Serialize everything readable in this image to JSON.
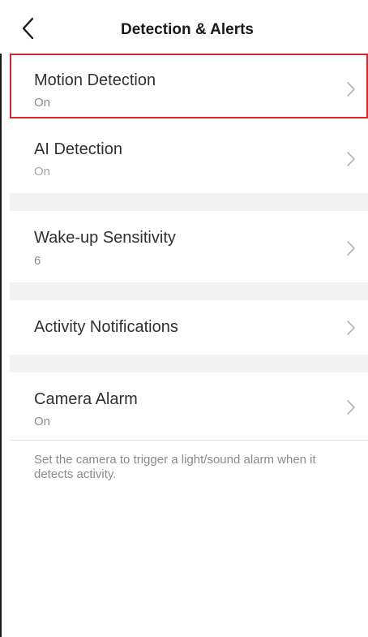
{
  "header": {
    "title": "Detection & Alerts",
    "back_icon": "chevron-left-icon"
  },
  "settings": {
    "motion_detection": {
      "label": "Motion Detection",
      "value": "On",
      "highlight_color": "#d3272a"
    },
    "ai_detection": {
      "label": "AI Detection",
      "value": "On"
    },
    "wakeup_sensitivity": {
      "label": "Wake-up Sensitivity",
      "value": "6"
    },
    "activity_notifications": {
      "label": "Activity Notifications"
    },
    "camera_alarm": {
      "label": "Camera Alarm",
      "value": "On",
      "description": "Set the camera to trigger a light/sound alarm when it detects activity."
    }
  },
  "icons": {
    "row_chevron": "chevron-right-icon"
  },
  "colors": {
    "section_gap": "#f3f3f3",
    "secondary_text": "#8c8c8c"
  }
}
